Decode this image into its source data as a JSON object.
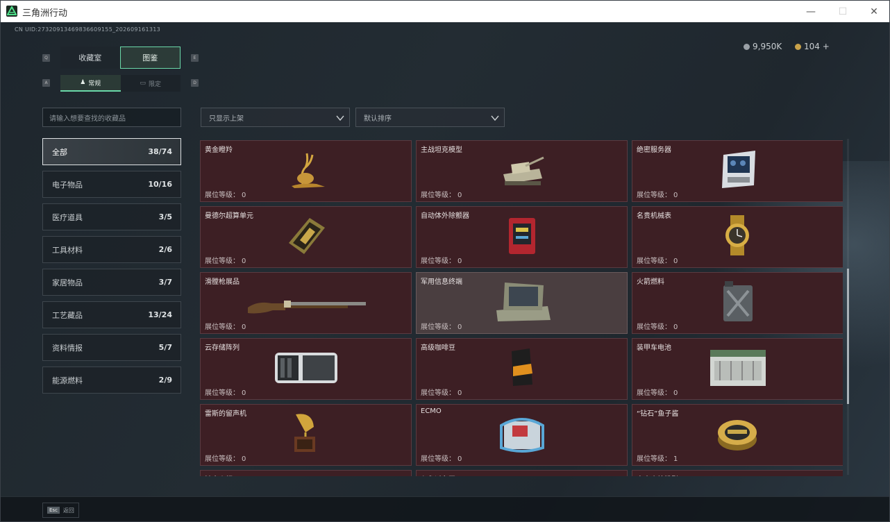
{
  "window": {
    "title": "三角洲行动",
    "minimize": "—",
    "maximize": "☐",
    "close": "✕"
  },
  "uid": "CN UID:2732091346983660915​5_202609161313",
  "currency": [
    {
      "icon": "coin-icon",
      "value": "9,950K",
      "color": "#9aa0a6"
    },
    {
      "icon": "gold-coin-icon",
      "value": "104 +",
      "color": "#c9a24a"
    }
  ],
  "keyhints": {
    "tab_left": "Q",
    "tab_right": "E",
    "sub_left": "A",
    "sub_right": "D"
  },
  "tabs": [
    {
      "label": "收藏室"
    },
    {
      "label": "图鉴"
    }
  ],
  "subtabs": [
    {
      "label": "常规"
    },
    {
      "label": "限定"
    }
  ],
  "search": {
    "placeholder": "请输入想要查找的收藏品"
  },
  "filters": [
    {
      "value": "只显示上架"
    },
    {
      "value": "默认排序"
    }
  ],
  "categories": [
    {
      "label": "全部",
      "count": "38/74"
    },
    {
      "label": "电子物品",
      "count": "10/16"
    },
    {
      "label": "医疗道具",
      "count": "3/5"
    },
    {
      "label": "工具材料",
      "count": "2/6"
    },
    {
      "label": "家居物品",
      "count": "3/7"
    },
    {
      "label": "工艺藏品",
      "count": "13/24"
    },
    {
      "label": "资料情报",
      "count": "5/7"
    },
    {
      "label": "能源燃料",
      "count": "2/9"
    }
  ],
  "level_label": "展位等级：",
  "items": [
    {
      "name": "黄金瞪羚",
      "level": "0",
      "icon": "golden-gazelle-icon"
    },
    {
      "name": "主战坦克模型",
      "level": "0",
      "icon": "tank-model-icon"
    },
    {
      "name": "绝密服务器",
      "level": "0",
      "icon": "server-icon"
    },
    {
      "name": "曼德尔超算单元",
      "level": "0",
      "icon": "compute-unit-icon"
    },
    {
      "name": "自动体外除颤器",
      "level": "0",
      "icon": "defibrillator-icon"
    },
    {
      "name": "名贵机械表",
      "level": "0",
      "icon": "watch-icon"
    },
    {
      "name": "滑膛枪展品",
      "level": "0",
      "icon": "musket-icon"
    },
    {
      "name": "军用信息终端",
      "level": "0",
      "icon": "terminal-icon"
    },
    {
      "name": "火箭燃料",
      "level": "0",
      "icon": "fuel-can-icon"
    },
    {
      "name": "云存储阵列",
      "level": "0",
      "icon": "storage-array-icon"
    },
    {
      "name": "高级咖啡豆",
      "level": "0",
      "icon": "coffee-bag-icon"
    },
    {
      "name": "装甲车电池",
      "level": "0",
      "icon": "battery-icon"
    },
    {
      "name": "雷斯的留声机",
      "level": "0",
      "icon": "gramophone-icon"
    },
    {
      "name": "ECMO",
      "level": "0",
      "icon": "ecmo-icon"
    },
    {
      "name": "“钻石”鱼子酱",
      "level": "1",
      "icon": "caviar-tin-icon"
    },
    {
      "name": "镀金火炬",
      "level": "",
      "icon": "partial-item-icon"
    },
    {
      "name": "印象派名画",
      "level": "",
      "icon": "partial-item-icon"
    },
    {
      "name": "突击步枪模型",
      "level": "",
      "icon": "partial-item-icon"
    }
  ],
  "footer": {
    "esc_key": "Esc",
    "esc_label": "返回"
  }
}
